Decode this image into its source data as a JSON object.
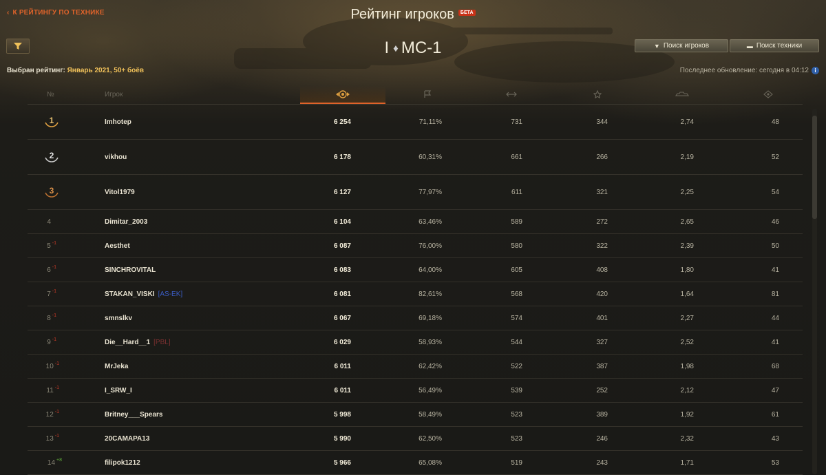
{
  "header": {
    "back_label": "К РЕЙТИНГУ ПО ТЕХНИКЕ",
    "title": "Рейтинг игроков",
    "beta_badge": "БЕТА",
    "vehicle_tier": "I",
    "vehicle_name": "МС-1",
    "search_players_label": "Поиск игроков",
    "search_vehicles_label": "Поиск техники",
    "rating_label": "Выбран рейтинг:",
    "rating_value": "Январь 2021, 50+ боёв",
    "last_update": "Последнее обновление: сегодня в 04:12",
    "info_icon_text": "i"
  },
  "table": {
    "columns": {
      "rank": "№",
      "player": "Игрок"
    },
    "rows": [
      {
        "rank": "1",
        "delta": "",
        "name": "Imhotep",
        "clan": "",
        "score": "6 254",
        "win": "71,11%",
        "dmg": "731",
        "exp": "344",
        "kills": "2,74",
        "spot": "48"
      },
      {
        "rank": "2",
        "delta": "",
        "name": "vikhou",
        "clan": "",
        "score": "6 178",
        "win": "60,31%",
        "dmg": "661",
        "exp": "266",
        "kills": "2,19",
        "spot": "52"
      },
      {
        "rank": "3",
        "delta": "",
        "name": "Vitol1979",
        "clan": "",
        "score": "6 127",
        "win": "77,97%",
        "dmg": "611",
        "exp": "321",
        "kills": "2,25",
        "spot": "54"
      },
      {
        "rank": "4",
        "delta": "",
        "name": "Dimitar_2003",
        "clan": "",
        "score": "6 104",
        "win": "63,46%",
        "dmg": "589",
        "exp": "272",
        "kills": "2,65",
        "spot": "46"
      },
      {
        "rank": "5",
        "delta": "-1",
        "name": "Aesthet",
        "clan": "",
        "score": "6 087",
        "win": "76,00%",
        "dmg": "580",
        "exp": "322",
        "kills": "2,39",
        "spot": "50"
      },
      {
        "rank": "6",
        "delta": "-1",
        "name": "SINCHROVITAL",
        "clan": "",
        "score": "6 083",
        "win": "64,00%",
        "dmg": "605",
        "exp": "408",
        "kills": "1,80",
        "spot": "41"
      },
      {
        "rank": "7",
        "delta": "-1",
        "name": "STAKAN_VISKI",
        "clan": "[AS-EK]",
        "clan_color": "#3b5cc4",
        "score": "6 081",
        "win": "82,61%",
        "dmg": "568",
        "exp": "420",
        "kills": "1,64",
        "spot": "81"
      },
      {
        "rank": "8",
        "delta": "-1",
        "name": "smnslkv",
        "clan": "",
        "score": "6 067",
        "win": "69,18%",
        "dmg": "574",
        "exp": "401",
        "kills": "2,27",
        "spot": "44"
      },
      {
        "rank": "9",
        "delta": "-1",
        "name": "Die__Hard__1",
        "clan": "[PBL]",
        "clan_color": "#7a3030",
        "score": "6 029",
        "win": "58,93%",
        "dmg": "544",
        "exp": "327",
        "kills": "2,52",
        "spot": "41"
      },
      {
        "rank": "10",
        "delta": "-1",
        "name": "MrJeka",
        "clan": "",
        "score": "6 011",
        "win": "62,42%",
        "dmg": "522",
        "exp": "387",
        "kills": "1,98",
        "spot": "68"
      },
      {
        "rank": "11",
        "delta": "-1",
        "name": "I_SRW_I",
        "clan": "",
        "score": "6 011",
        "win": "56,49%",
        "dmg": "539",
        "exp": "252",
        "kills": "2,12",
        "spot": "47"
      },
      {
        "rank": "12",
        "delta": "-1",
        "name": "Britney___Spears",
        "clan": "",
        "score": "5 998",
        "win": "58,49%",
        "dmg": "523",
        "exp": "389",
        "kills": "1,92",
        "spot": "61"
      },
      {
        "rank": "13",
        "delta": "-1",
        "name": "20CAMAPA13",
        "clan": "",
        "score": "5 990",
        "win": "62,50%",
        "dmg": "523",
        "exp": "246",
        "kills": "2,32",
        "spot": "43"
      },
      {
        "rank": "14",
        "delta": "+8",
        "name": "filipok1212",
        "clan": "",
        "score": "5 966",
        "win": "65,08%",
        "dmg": "519",
        "exp": "243",
        "kills": "1,71",
        "spot": "53"
      }
    ]
  },
  "colors": {
    "accent": "#e0632a",
    "rating_value": "#f0c15a",
    "delta_down": "#c83a28",
    "delta_up": "#5ea83a"
  },
  "icons": [
    "filter-icon",
    "player-search-icon",
    "tank-icon",
    "rating-emblem-icon",
    "flag-icon",
    "damage-icon",
    "experience-icon",
    "kills-icon",
    "spotted-icon",
    "info-icon",
    "diamond-icon"
  ]
}
